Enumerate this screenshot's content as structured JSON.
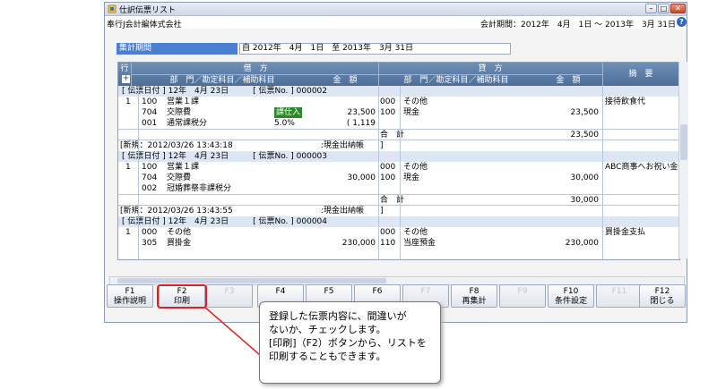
{
  "window": {
    "title": "仕訳伝票リスト",
    "company": "奉行J会計編体式会社",
    "period": "会計期間：2012年　4月　1日 ～ 2013年　3月 31日"
  },
  "range": {
    "label": "集計期間",
    "value": "自 2012年　4月　1日　至 2013年　3月 31日"
  },
  "grid": {
    "row_label": "行",
    "debit_header": "借　方",
    "credit_header": "貸　方",
    "dept_account": "部　門／勘定科目／補助科目",
    "amount": "金　額",
    "summary": "摘　要",
    "vouchers": [
      {
        "header": "[ 伝票日付 ] 12年　4月 23日　　　[ 伝票No. ] 000002",
        "lines": [
          {
            "no": "1",
            "dcode": "100",
            "dname": "営業１課",
            "ccode": "000",
            "cname": "その他",
            "memo": "接待飲食代"
          },
          {
            "dcode": "704",
            "dname": "交際費",
            "dbadge": "課仕入",
            "damount": "23,500",
            "ccode": "100",
            "cname": "現金",
            "camount": "23,500"
          },
          {
            "dcode": "001",
            "dname": "通常課税分",
            "drate": "5.0%",
            "dtax": "( 1,119"
          }
        ],
        "total_label": "合　計",
        "total": "23,500",
        "footer_left": "[新規：2012/03/26 13:43:18",
        "footer_mid": ":現金出納帳　　]"
      },
      {
        "header": "[ 伝票日付 ] 12年　4月 23日　　　[ 伝票No. ] 000003",
        "lines": [
          {
            "no": "1",
            "dcode": "100",
            "dname": "営業１課",
            "ccode": "000",
            "cname": "その他",
            "memo": "ABC商事へお祝い金支払"
          },
          {
            "dcode": "704",
            "dname": "交際費",
            "damount": "30,000",
            "ccode": "100",
            "cname": "現金",
            "camount": "30,000"
          },
          {
            "dcode": "002",
            "dname": "冠婚葬祭非課税分"
          }
        ],
        "total_label": "合　計",
        "total": "30,000",
        "footer_left": "[新規：2012/03/26 13:43:55",
        "footer_mid": ":現金出納帳　　]"
      },
      {
        "header": "[ 伝票日付 ] 12年　4月 23日　　　[ 伝票No. ] 000004",
        "lines": [
          {
            "no": "1",
            "dcode": "000",
            "dname": "その他",
            "ccode": "000",
            "cname": "その他",
            "memo": "買掛金支払"
          },
          {
            "dcode": "305",
            "dname": "買掛金",
            "damount": "230,000",
            "ccode": "110",
            "cname": "当座預金",
            "camount": "230,000"
          }
        ]
      }
    ]
  },
  "fkeys": [
    {
      "key": "F1",
      "label": "操作説明",
      "enabled": true
    },
    {
      "key": "F2",
      "label": "印刷",
      "enabled": true
    },
    {
      "key": "F3",
      "label": "",
      "enabled": false
    },
    {
      "key": "F4",
      "label": "",
      "enabled": true
    },
    {
      "key": "F5",
      "label": "",
      "enabled": true
    },
    {
      "key": "F6",
      "label": "",
      "enabled": true
    },
    {
      "key": "F7",
      "label": "",
      "enabled": false
    },
    {
      "key": "F8",
      "label": "再集計",
      "enabled": true
    },
    {
      "key": "F9",
      "label": "",
      "enabled": false
    },
    {
      "key": "F10",
      "label": "条件設定",
      "enabled": true
    },
    {
      "key": "F11",
      "label": "",
      "enabled": false
    },
    {
      "key": "F12",
      "label": "閉じる",
      "enabled": true
    }
  ],
  "callout": {
    "line1": "登録した伝票内容に、間違いが",
    "line2": "ないか、チェックします。",
    "line3": "[印刷]（F2）ボタンから、リストを",
    "line4": "印刷することもできます。"
  },
  "colors": {
    "accent": "#4b7fd0",
    "highlight": "#e02020",
    "header": "#5676a0"
  }
}
